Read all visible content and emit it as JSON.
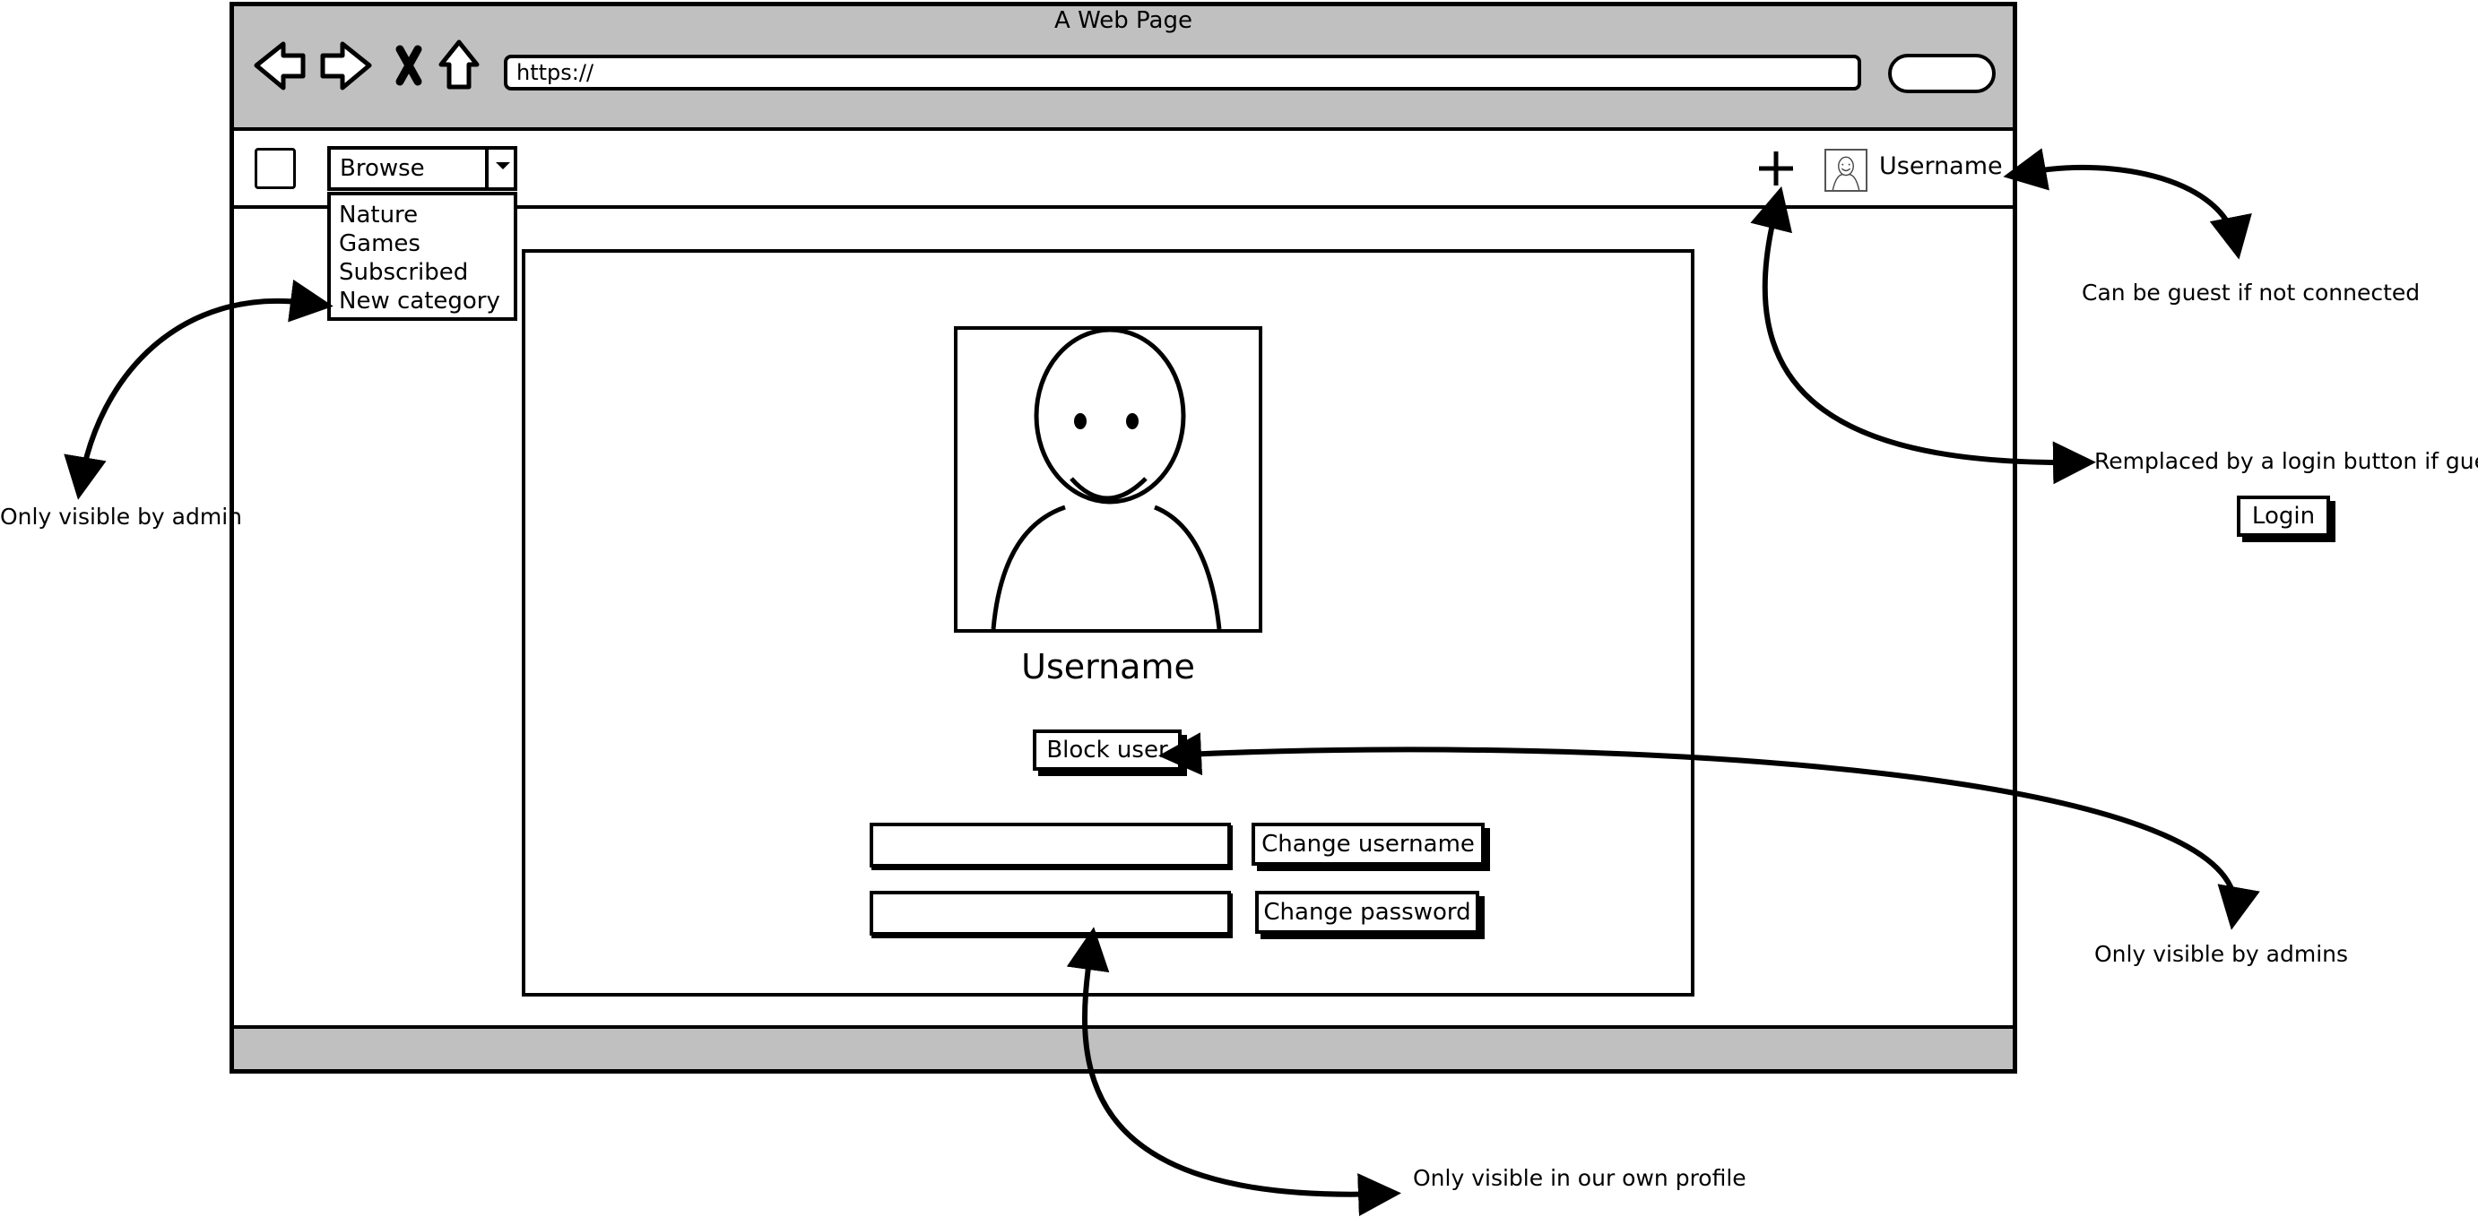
{
  "browser": {
    "title": "A Web Page",
    "url": "https://"
  },
  "nav": {
    "browse_label": "Browse",
    "browse_options": [
      "Nature",
      "Games",
      "Subscribed",
      "New category"
    ],
    "username": "Username"
  },
  "profile": {
    "username": "Username",
    "block_user_label": "Block user",
    "change_username_label": "Change username",
    "change_password_label": "Change password"
  },
  "annotations": {
    "guest": "Can be guest if not connected",
    "login_replace": "Remplaced by a login button if guest",
    "login_button": "Login",
    "admin_only": "Only visible by admin",
    "admins_only": "Only visible by admins",
    "own_profile": "Only visible in our own profile"
  }
}
